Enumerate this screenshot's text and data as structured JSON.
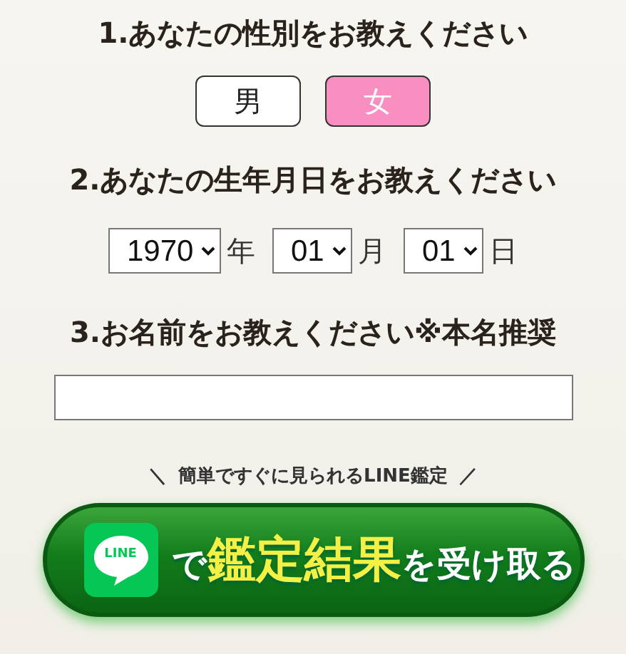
{
  "q1": {
    "heading": "1.あなたの性別をお教えください",
    "options": [
      {
        "label": "男",
        "selected": false
      },
      {
        "label": "女",
        "selected": true
      }
    ]
  },
  "q2": {
    "heading": "2.あなたの生年月日をお教えください",
    "fields": [
      {
        "value": "1970",
        "unit": "年"
      },
      {
        "value": "01",
        "unit": "月"
      },
      {
        "value": "01",
        "unit": "日"
      }
    ]
  },
  "q3": {
    "heading": "3.お名前をお教えください※本名推奨"
  },
  "caption": {
    "left": "＼",
    "text": "簡単ですぐに見られるLINE鑑定",
    "right": "／"
  },
  "submit": {
    "logo_text": "LINE",
    "parts": [
      {
        "text": "で",
        "kind": "plain"
      },
      {
        "text": "鑑定結果",
        "kind": "highlight"
      },
      {
        "text": "を受け取る",
        "kind": "plain"
      }
    ]
  }
}
